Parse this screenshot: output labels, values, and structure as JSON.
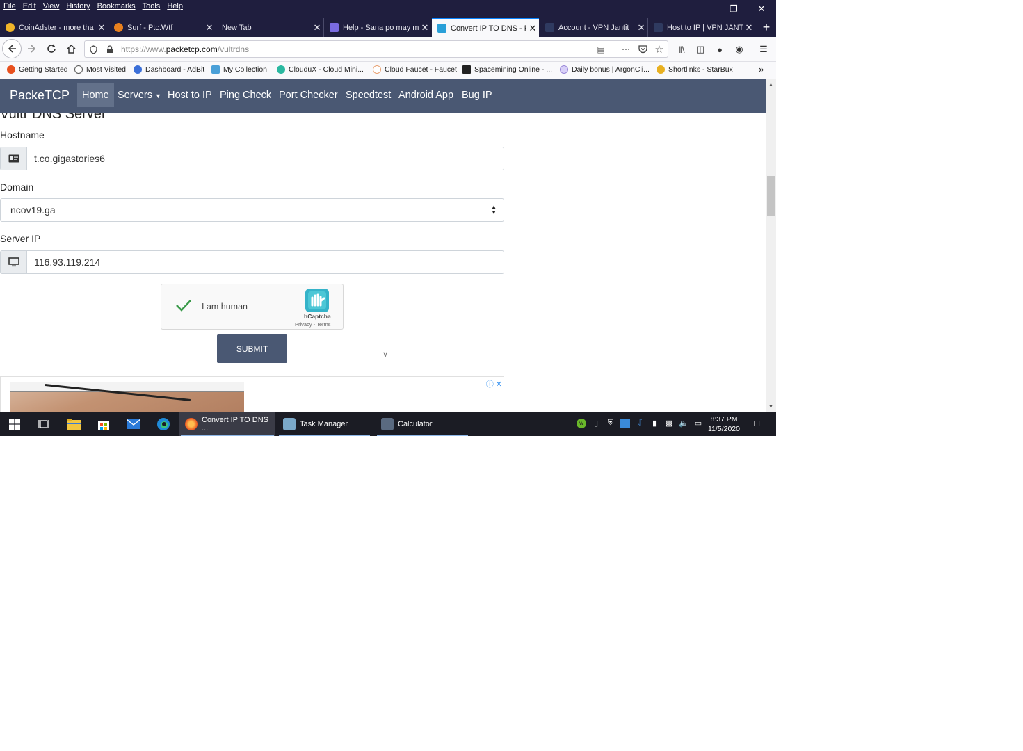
{
  "menubar": {
    "items": [
      "File",
      "Edit",
      "View",
      "History",
      "Bookmarks",
      "Tools",
      "Help"
    ]
  },
  "tabs": [
    {
      "title": "CoinAdster - more tha",
      "icon": "coin-icon",
      "color": "#f0b429"
    },
    {
      "title": "Surf - Ptc.Wtf",
      "icon": "surf-icon",
      "color": "#e8801e"
    },
    {
      "title": "New Tab",
      "icon": "",
      "color": ""
    },
    {
      "title": "Help - Sana po may m",
      "icon": "shield-icon",
      "color": "#7a6be0"
    },
    {
      "title": "Convert IP TO DNS - F",
      "icon": "packetcp-icon",
      "color": "#2aa0d8"
    },
    {
      "title": "Account - VPN Jantit",
      "icon": "vpn-icon",
      "color": "#2f3a60"
    },
    {
      "title": "Host to IP | VPN JANT",
      "icon": "vpn-icon",
      "color": "#2f3a60"
    }
  ],
  "url": {
    "prefix": "https://www.",
    "domain": "packetcp.com",
    "path": "/vultrdns"
  },
  "bookmarks": [
    {
      "label": "Getting Started",
      "icon": "firefox-icon",
      "color": "#e8501e"
    },
    {
      "label": "Most Visited",
      "icon": "gear-icon",
      "color": "#555555"
    },
    {
      "label": "Dashboard - AdBit",
      "icon": "adbit-icon",
      "color": "#3b6fd8"
    },
    {
      "label": "My Collection",
      "icon": "collection-icon",
      "color": "#4aa0d8"
    },
    {
      "label": "ClouduX - Cloud Mini...",
      "icon": "cloudux-icon",
      "color": "#2ab8a0"
    },
    {
      "label": "Cloud Faucet - Faucet",
      "icon": "cloud-icon",
      "color": "#e8a070"
    },
    {
      "label": "Spacemining Online - ...",
      "icon": "spacemining-icon",
      "color": "#222222"
    },
    {
      "label": "Daily bonus | ArgonCli...",
      "icon": "argon-icon",
      "color": "#9a88d8"
    },
    {
      "label": "Shortlinks - StarBux",
      "icon": "starbux-icon",
      "color": "#e8b020"
    }
  ],
  "site": {
    "brand": "PackeTCP",
    "nav": [
      "Home",
      "Servers",
      "Host to IP",
      "Ping Check",
      "Port Checker",
      "Speedtest",
      "Android App",
      "Bug IP"
    ],
    "accent": "#4a5873"
  },
  "form": {
    "title": "Vultr DNS Server",
    "hostname_label": "Hostname",
    "hostname_value": "t.co.gigastories6",
    "domain_label": "Domain",
    "domain_value": "ncov19.ga",
    "server_ip_label": "Server IP",
    "server_ip_value": "116.93.119.214",
    "submit_label": "SUBMIT"
  },
  "captcha": {
    "text": "I am human",
    "brand": "hCaptcha",
    "links": "Privacy - Terms",
    "checked": true
  },
  "taskbar": {
    "apps": [
      {
        "label": "Convert IP TO DNS ...",
        "icon": "firefox-icon"
      },
      {
        "label": "Task Manager",
        "icon": "task-manager-icon"
      },
      {
        "label": "Calculator",
        "icon": "calculator-icon"
      }
    ],
    "time": "8:37 PM",
    "date": "11/5/2020"
  }
}
